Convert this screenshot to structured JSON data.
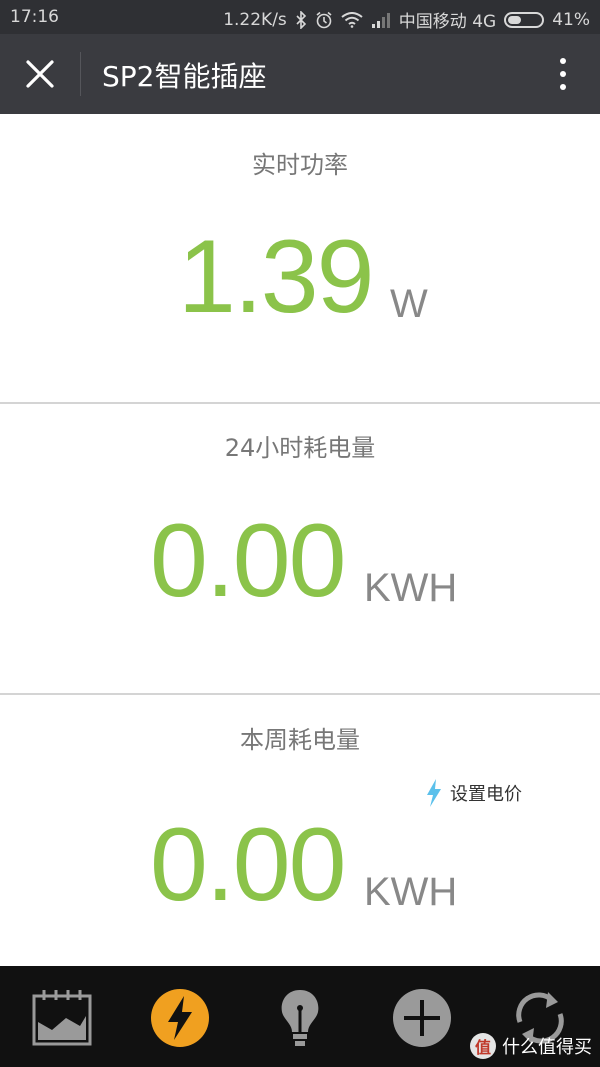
{
  "status": {
    "time": "17:16",
    "speed": "1.22K/s",
    "carrier": "中国移动 4G",
    "battery": "41%",
    "battery_level": 0.41
  },
  "appbar": {
    "title": "SP2智能插座"
  },
  "realtime": {
    "label": "实时功率",
    "value": "1.39",
    "unit": "W"
  },
  "daily": {
    "label": "24小时耗电量",
    "value": "0.00",
    "unit": "KWH"
  },
  "weekly": {
    "label": "本周耗电量",
    "value": "0.00",
    "unit": "KWH",
    "set_price_label": "设置电价"
  },
  "colors": {
    "accent": "#8bc34a",
    "active_tab": "#f0a020",
    "bar": "#3a3b40"
  },
  "bottom_tabs": [
    {
      "icon": "chart-icon"
    },
    {
      "icon": "power-bolt-icon",
      "active": true
    },
    {
      "icon": "bulb-icon"
    },
    {
      "icon": "plus-icon"
    },
    {
      "icon": "refresh-icon"
    }
  ],
  "watermark": {
    "mark": "值",
    "text": "什么值得买"
  }
}
